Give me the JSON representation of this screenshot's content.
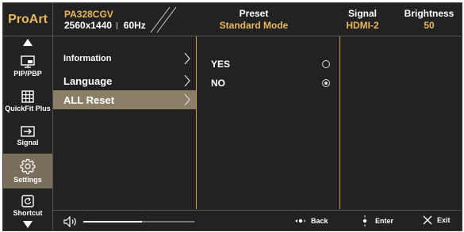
{
  "header": {
    "brand": "ProArt",
    "model": "PA328CGV",
    "resolution": "2560x1440",
    "refresh": "60Hz",
    "preset_label": "Preset",
    "preset_value": "Standard Mode",
    "signal_label": "Signal",
    "signal_value": "HDMI-2",
    "brightness_label": "Brightness",
    "brightness_value": "50"
  },
  "sidebar": {
    "items": [
      {
        "label": "PIP/PBP",
        "icon": "pip-icon"
      },
      {
        "label": "QuickFit Plus",
        "icon": "grid-icon"
      },
      {
        "label": "Signal",
        "icon": "input-icon"
      },
      {
        "label": "Settings",
        "icon": "gear-icon",
        "active": true
      },
      {
        "label": "Shortcut",
        "icon": "shortcut-icon"
      }
    ]
  },
  "menu": {
    "items": [
      {
        "label": "Information"
      },
      {
        "label": "Language"
      },
      {
        "label": "ALL Reset",
        "active": true
      }
    ]
  },
  "options": {
    "items": [
      {
        "label": "YES",
        "selected": false
      },
      {
        "label": "NO",
        "selected": true
      }
    ]
  },
  "footer": {
    "volume_level": 0.53,
    "back_label": "Back",
    "enter_label": "Enter",
    "exit_label": "Exit"
  },
  "colors": {
    "accent": "#e8b85c",
    "active_bg": "#8b7f68",
    "background": "#222222"
  }
}
